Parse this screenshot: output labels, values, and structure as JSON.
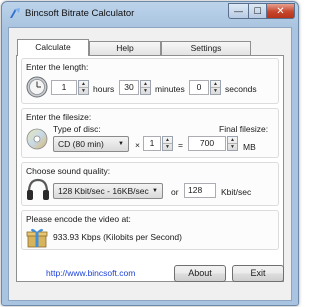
{
  "window": {
    "title": "Bincsoft Bitrate Calculator",
    "controls": {
      "minimize": "—",
      "maximize": "☐",
      "close": "✕"
    }
  },
  "tabs": [
    {
      "label": "Calculate",
      "active": true
    },
    {
      "label": "Help",
      "active": false
    },
    {
      "label": "Settings",
      "active": false
    }
  ],
  "length": {
    "heading": "Enter the length:",
    "hours_value": "1",
    "hours_label": "hours",
    "minutes_value": "30",
    "minutes_label": "minutes",
    "seconds_value": "0",
    "seconds_label": "seconds"
  },
  "filesize": {
    "heading": "Enter the filesize:",
    "disc_type_label": "Type of disc:",
    "disc_type_value": "CD (80 min)",
    "multiply_sign": "×",
    "count_value": "1",
    "equals_sign": "=",
    "final_label": "Final filesize:",
    "final_value": "700",
    "final_unit": "MB"
  },
  "sound": {
    "heading": "Choose sound quality:",
    "quality_value": "128 Kbit/sec - 16KB/sec",
    "or_label": "or",
    "custom_value": "128",
    "custom_unit": "Kbit/sec"
  },
  "result": {
    "heading": "Please encode the video at:",
    "value": "933.93 Kbps (Kilobits per Second)"
  },
  "footer": {
    "link": "http://www.bincsoft.com",
    "about_label": "About",
    "exit_label": "Exit"
  },
  "colors": {
    "title_bar": "#bcd3ea",
    "close_button": "#c6452b",
    "link": "#1a3fd6"
  },
  "icons": [
    "app-icon",
    "clock-icon",
    "cd-disc-icon",
    "headphones-icon",
    "gift-box-icon"
  ]
}
